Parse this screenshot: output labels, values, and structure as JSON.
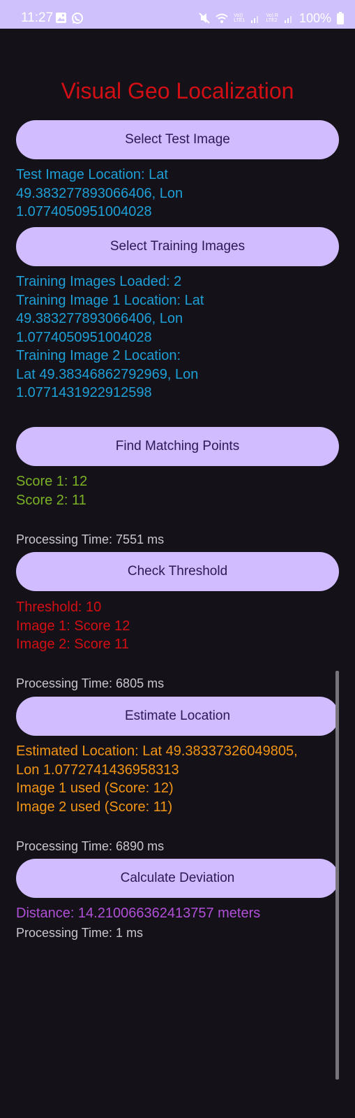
{
  "status_bar": {
    "time": "11:27",
    "signal_1": "Vo))\nLTE1",
    "signal_2": "Vo) R\nLTE2",
    "battery": "100%"
  },
  "app": {
    "title": "Visual Geo Localization",
    "buttons": {
      "select_test_image": "Select Test Image",
      "select_training_images": "Select Training Images",
      "find_matching_points": "Find Matching Points",
      "check_threshold": "Check Threshold",
      "estimate_location": "Estimate Location",
      "calculate_deviation": "Calculate Deviation"
    },
    "test_image_location": [
      "Test Image Location: Lat",
      "49.383277893066406, Lon",
      "1.0774050951004028"
    ],
    "training_info": [
      "Training Images Loaded: 2",
      "Training Image 1 Location: Lat",
      "49.383277893066406, Lon",
      "1.0774050951004028",
      "Training Image 2 Location:",
      "Lat 49.38346862792969, Lon",
      "1.0771431922912598"
    ],
    "scores": [
      "Score 1: 12",
      "Score 2: 11"
    ],
    "processing_time_matching": "Processing Time: 7551 ms",
    "threshold_info": [
      "Threshold: 10",
      "Image 1: Score 12",
      "Image 2: Score 11"
    ],
    "processing_time_threshold": "Processing Time: 6805 ms",
    "estimated_location": [
      "Estimated Location: Lat 49.38337326049805,",
      "Lon 1.0772741436958313",
      "Image 1 used (Score: 12)",
      "Image 2 used (Score: 11)"
    ],
    "processing_time_estimate": "Processing Time: 6890 ms",
    "distance": "Distance: 14.210066362413757 meters",
    "processing_time_deviation": "Processing Time: 1 ms"
  },
  "colors": {
    "background": "#141218",
    "status_bar": "#cfc1fb",
    "button": "#d0bcff",
    "title": "#d20f14",
    "location_text": "#1e9fd6",
    "score_text": "#7bb225",
    "threshold_text": "#d20f14",
    "estimate_text": "#f39516",
    "distance_text": "#b04fd8"
  },
  "icons": [
    "image-icon",
    "whatsapp-icon",
    "mute-icon",
    "wifi-icon",
    "signal-icon",
    "battery-icon"
  ]
}
